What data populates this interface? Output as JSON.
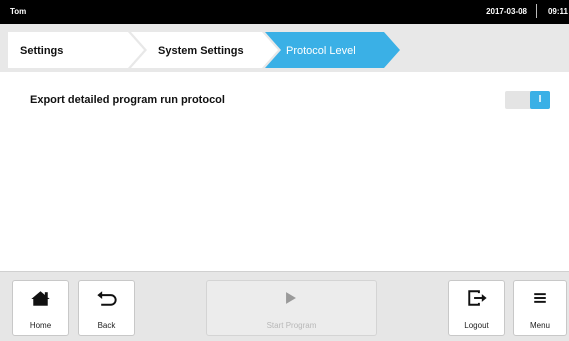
{
  "status_bar": {
    "user": "Tom",
    "date": "2017-03-08",
    "time": "09:11"
  },
  "breadcrumb": [
    {
      "label": "Settings",
      "active": false
    },
    {
      "label": "System Settings",
      "active": false
    },
    {
      "label": "Protocol Level",
      "active": true
    }
  ],
  "setting": {
    "label": "Export detailed program run protocol",
    "toggle_symbol": "I",
    "enabled": true
  },
  "footer": {
    "home": "Home",
    "back": "Back",
    "start_program": "Start Program",
    "logout": "Logout",
    "menu": "Menu"
  },
  "colors": {
    "accent": "#3ab0e6",
    "crumb_inactive": "#ffffff",
    "bar_background": "#e6e6e6"
  },
  "icons": {
    "home": "home-icon",
    "back": "undo-arrow-icon",
    "start": "play-icon",
    "logout": "logout-icon",
    "menu": "hamburger-icon"
  }
}
